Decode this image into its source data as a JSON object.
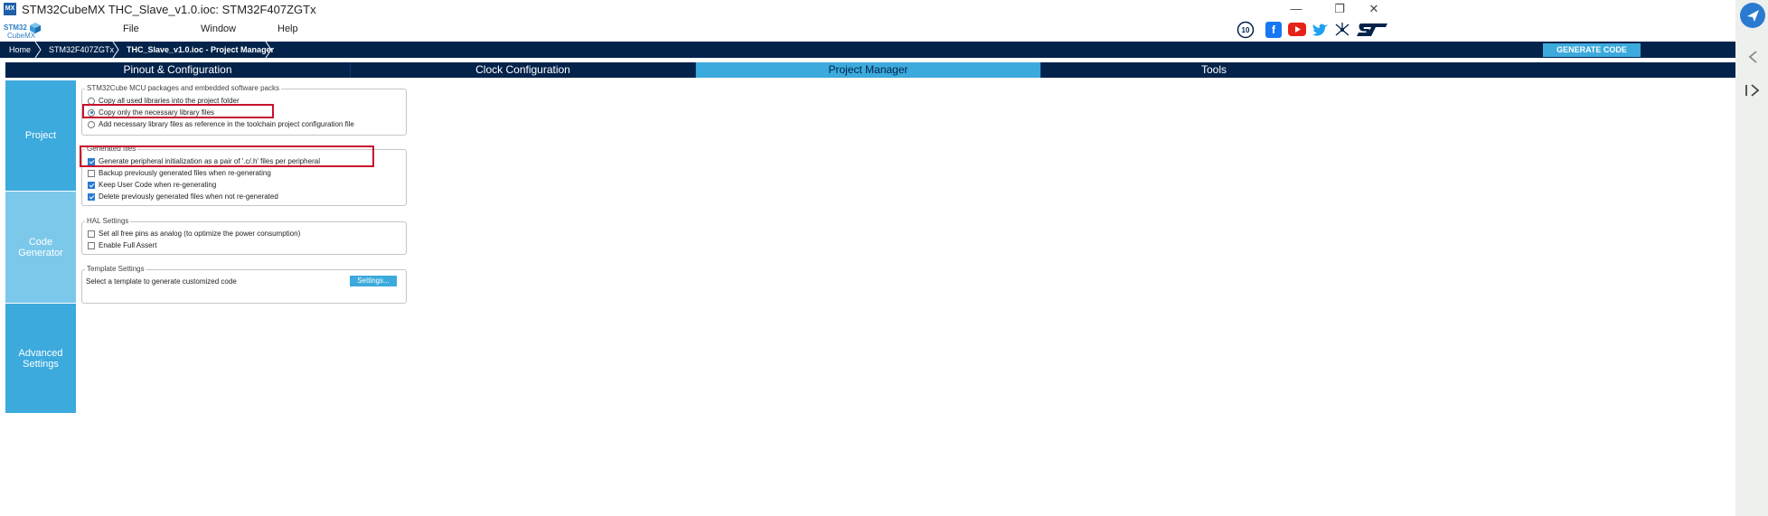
{
  "window": {
    "logo_text": "MX",
    "title": "STM32CubeMX THC_Slave_v1.0.ioc: STM32F407ZGTx",
    "minimize": "—",
    "restore": "❐",
    "close": "✕"
  },
  "menu": {
    "logo_line1": "STM32",
    "logo_line2": "CubeMX",
    "items": [
      {
        "label": "File"
      },
      {
        "label": "Window"
      },
      {
        "label": "Help"
      }
    ],
    "icons": [
      "anniversary-10-icon",
      "facebook-icon",
      "youtube-icon",
      "twitter-icon",
      "network-icon",
      "st-logo-icon"
    ]
  },
  "breadcrumb": {
    "items": [
      {
        "label": "Home"
      },
      {
        "label": "STM32F407ZGTx"
      },
      {
        "label": "THC_Slave_v1.0.ioc - Project Manager"
      }
    ],
    "generate_code_label": "GENERATE CODE"
  },
  "tabs": [
    {
      "label": "Pinout & Configuration",
      "active": false
    },
    {
      "label": "Clock Configuration",
      "active": false
    },
    {
      "label": "Project Manager",
      "active": true
    },
    {
      "label": "Tools",
      "active": false
    }
  ],
  "sidenav": [
    {
      "label": "Project"
    },
    {
      "label": "Code Generator"
    },
    {
      "label": "Advanced Settings"
    }
  ],
  "packages": {
    "title": "STM32Cube MCU packages and embedded software packs",
    "options": [
      {
        "label": "Copy all used libraries into the project folder",
        "selected": false
      },
      {
        "label": "Copy only the necessary library files",
        "selected": true
      },
      {
        "label": "Add necessary library files as reference in the toolchain project configuration file",
        "selected": false
      }
    ]
  },
  "generated_files": {
    "title": "Generated files",
    "options": [
      {
        "label": "Generate peripheral initialization as a pair of '.c/.h' files per peripheral",
        "checked": true
      },
      {
        "label": "Backup previously generated files when re-generating",
        "checked": false
      },
      {
        "label": "Keep User Code when re-generating",
        "checked": true
      },
      {
        "label": "Delete previously generated files when not re-generated",
        "checked": true
      }
    ]
  },
  "hal_settings": {
    "title": "HAL Settings",
    "options": [
      {
        "label": "Set all free pins as analog (to optimize the power consumption)",
        "checked": false
      },
      {
        "label": "Enable Full Assert",
        "checked": false
      }
    ]
  },
  "template_settings": {
    "title": "Template Settings",
    "description": "Select a template to generate customized code",
    "button_label": "Settings..."
  },
  "colors": {
    "navy": "#03234b",
    "accent": "#3caadd",
    "highlight": "#c8102e"
  }
}
